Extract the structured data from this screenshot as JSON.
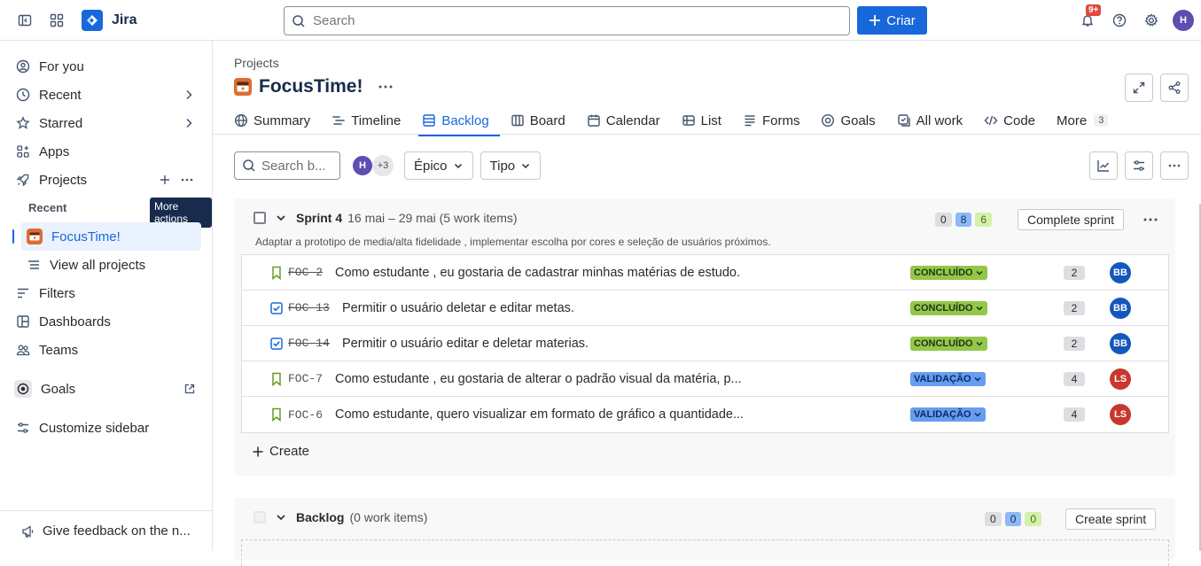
{
  "topbar": {
    "brand": "Jira",
    "search_placeholder": "Search",
    "create_label": "Criar",
    "notif_badge": "9+",
    "user_initial": "H"
  },
  "sidebar": {
    "items": [
      {
        "label": "For you",
        "icon": "user-circle-icon"
      },
      {
        "label": "Recent",
        "icon": "clock-icon"
      },
      {
        "label": "Starred",
        "icon": "star-icon"
      },
      {
        "label": "Apps",
        "icon": "apps-icon"
      },
      {
        "label": "Projects",
        "icon": "rocket-icon"
      }
    ],
    "recent_heading": "Recent",
    "tooltip": "More actions",
    "project_item": "FocusTime!",
    "view_all": "View all projects",
    "lower_items": [
      {
        "label": "Filters",
        "icon": "filter-icon"
      },
      {
        "label": "Dashboards",
        "icon": "dashboard-icon"
      },
      {
        "label": "Teams",
        "icon": "teams-icon"
      },
      {
        "label": "Goals",
        "icon": "goals-icon"
      },
      {
        "label": "Customize sidebar",
        "icon": "customize-icon"
      }
    ],
    "feedback": "Give feedback on the n..."
  },
  "main": {
    "breadcrumb": "Projects",
    "project_name": "FocusTime!",
    "tabs": [
      {
        "label": "Summary",
        "icon": "globe-icon"
      },
      {
        "label": "Timeline",
        "icon": "timeline-icon"
      },
      {
        "label": "Backlog",
        "icon": "backlog-icon"
      },
      {
        "label": "Board",
        "icon": "board-icon"
      },
      {
        "label": "Calendar",
        "icon": "calendar-icon"
      },
      {
        "label": "List",
        "icon": "list-icon"
      },
      {
        "label": "Forms",
        "icon": "forms-icon"
      },
      {
        "label": "Goals",
        "icon": "goals-icon"
      },
      {
        "label": "All work",
        "icon": "allwork-icon"
      },
      {
        "label": "Code",
        "icon": "code-icon"
      },
      {
        "label": "More",
        "icon": ""
      }
    ],
    "more_count": "3",
    "active_tab": "Backlog",
    "filters": {
      "search_placeholder": "Search b...",
      "avatar_initial": "H",
      "more_avatars": "+3",
      "epic_label": "Épico",
      "type_label": "Tipo"
    }
  },
  "sprint": {
    "name": "Sprint 4",
    "dates": "16 mai – 29 mai (5 work items)",
    "count_todo": "0",
    "count_progress": "8",
    "count_done": "6",
    "complete_label": "Complete sprint",
    "goal": "Adaptar a prototipo de media/alta fidelidade , implementar escolha por cores e seleção de usuários próximos.",
    "items": [
      {
        "type": "story",
        "key": "FOC-2",
        "summary": "Como estudante , eu gostaria de cadastrar minhas matérias de estudo.",
        "status": "CONCLUÍDO",
        "points": "2",
        "assignee": "BB",
        "color": "#1558bc"
      },
      {
        "type": "task",
        "key": "FOC-13",
        "summary": "Permitir o usuário deletar e editar metas.",
        "status": "CONCLUÍDO",
        "points": "2",
        "assignee": "BB",
        "color": "#1558bc"
      },
      {
        "type": "task",
        "key": "FOC-14",
        "summary": "Permitir o usuário editar e deletar materias.",
        "status": "CONCLUÍDO",
        "points": "2",
        "assignee": "BB",
        "color": "#1558bc"
      },
      {
        "type": "story",
        "key": "FOC-7",
        "summary": "Como estudante , eu gostaria de alterar o padrão visual da matéria, p...",
        "status": "VALIDAÇÃO",
        "points": "4",
        "assignee": "LS",
        "color": "#c9372c"
      },
      {
        "type": "story",
        "key": "FOC-6",
        "summary": "Como estudante, quero visualizar em formato de gráfico a quantidade...",
        "status": "VALIDAÇÃO",
        "points": "4",
        "assignee": "LS",
        "color": "#c9372c"
      }
    ],
    "create_label": "Create"
  },
  "backlog": {
    "name": "Backlog",
    "count_text": "(0 work items)",
    "count_todo": "0",
    "count_progress": "0",
    "count_done": "0",
    "create_sprint_label": "Create sprint"
  }
}
